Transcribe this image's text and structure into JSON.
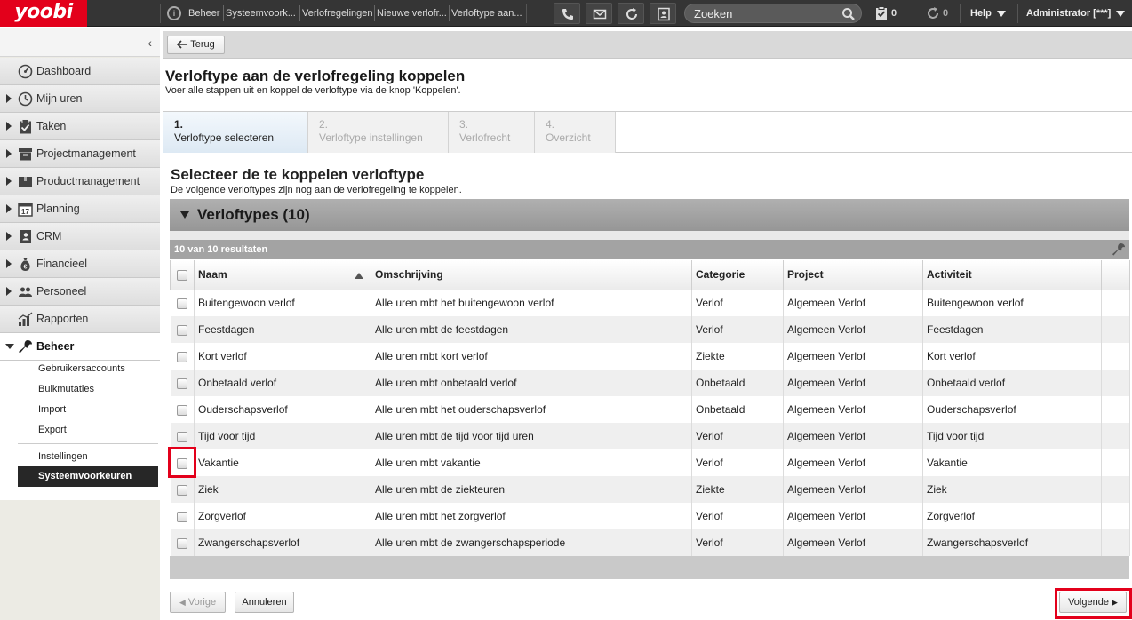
{
  "app": {
    "logo": "yoobi",
    "breadcrumbs": [
      "Beheer",
      "Systeemvoork...",
      "Verlofregelingen",
      "Nieuwe verlofr...",
      "Verloftype aan..."
    ],
    "search_placeholder": "Zoeken",
    "task_count": "0",
    "sync_count": "0",
    "help_label": "Help",
    "user_label": "Administrator [***]"
  },
  "sidebar": {
    "items": [
      {
        "label": "Dashboard",
        "icon": "dashboard-icon"
      },
      {
        "label": "Mijn uren",
        "icon": "clock-icon"
      },
      {
        "label": "Taken",
        "icon": "clipboard-check-icon"
      },
      {
        "label": "Projectmanagement",
        "icon": "drawer-icon"
      },
      {
        "label": "Productmanagement",
        "icon": "box-icon"
      },
      {
        "label": "Planning",
        "icon": "calendar-icon"
      },
      {
        "label": "CRM",
        "icon": "contact-book-icon"
      },
      {
        "label": "Financieel",
        "icon": "money-bag-icon"
      },
      {
        "label": "Personeel",
        "icon": "people-icon"
      },
      {
        "label": "Rapporten",
        "icon": "chart-icon"
      }
    ],
    "calendar_day": "17",
    "beheer": {
      "label": "Beheer",
      "sub": [
        "Gebruikersaccounts",
        "Bulkmutaties",
        "Import",
        "Export"
      ],
      "sub2": [
        "Instellingen",
        "Systeemvoorkeuren"
      ]
    }
  },
  "main": {
    "back_label": "Terug",
    "title": "Verloftype aan de verlofregeling koppelen",
    "subtitle": "Voer alle stappen uit en koppel de verloftype via de knop 'Koppelen'.",
    "steps": [
      {
        "num": "1.",
        "label": "Verloftype selecteren"
      },
      {
        "num": "2.",
        "label": "Verloftype instellingen"
      },
      {
        "num": "3.",
        "label": "Verlofrecht"
      },
      {
        "num": "4.",
        "label": "Overzicht"
      }
    ],
    "section_title": "Selecteer de te koppelen verloftype",
    "section_sub": "De volgende verloftypes zijn nog aan de verlofregeling te koppelen.",
    "panel_title": "Verloftypes (10)",
    "results": "10 van 10 resultaten",
    "columns": [
      "Naam",
      "Omschrijving",
      "Categorie",
      "Project",
      "Activiteit"
    ],
    "rows": [
      [
        "Buitengewoon verlof",
        "Alle uren mbt het buitengewoon verlof",
        "Verlof",
        "Algemeen Verlof",
        "Buitengewoon verlof"
      ],
      [
        "Feestdagen",
        "Alle uren mbt de feestdagen",
        "Verlof",
        "Algemeen Verlof",
        "Feestdagen"
      ],
      [
        "Kort verlof",
        "Alle uren mbt kort verlof",
        "Ziekte",
        "Algemeen Verlof",
        "Kort verlof"
      ],
      [
        "Onbetaald verlof",
        "Alle uren mbt onbetaald verlof",
        "Onbetaald",
        "Algemeen Verlof",
        "Onbetaald verlof"
      ],
      [
        "Ouderschapsverlof",
        "Alle uren mbt het ouderschapsverlof",
        "Onbetaald",
        "Algemeen Verlof",
        "Ouderschapsverlof"
      ],
      [
        "Tijd voor tijd",
        "Alle uren mbt de tijd voor tijd uren",
        "Verlof",
        "Algemeen Verlof",
        "Tijd voor tijd"
      ],
      [
        "Vakantie",
        "Alle uren mbt vakantie",
        "Verlof",
        "Algemeen Verlof",
        "Vakantie"
      ],
      [
        "Ziek",
        "Alle uren mbt de ziekteuren",
        "Ziekte",
        "Algemeen Verlof",
        "Ziek"
      ],
      [
        "Zorgverlof",
        "Alle uren mbt het zorgverlof",
        "Verlof",
        "Algemeen Verlof",
        "Zorgverlof"
      ],
      [
        "Zwangerschapsverlof",
        "Alle uren mbt de zwangerschapsperiode",
        "Verlof",
        "Algemeen Verlof",
        "Zwangerschapsverlof"
      ]
    ],
    "prev_label": "Vorige",
    "cancel_label": "Annuleren",
    "next_label": "Volgende"
  },
  "colors": {
    "brand_red": "#e3001b",
    "topbar": "#353535",
    "highlight": "#e3001b"
  }
}
